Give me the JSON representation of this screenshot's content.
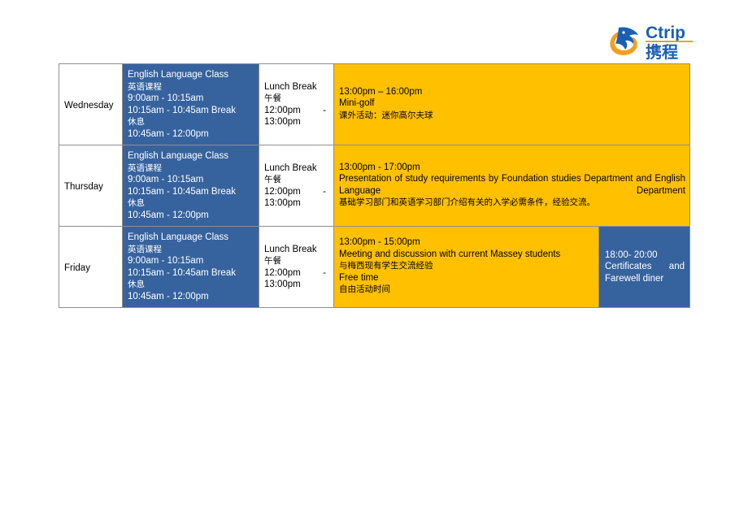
{
  "brand": {
    "name": "Ctrip",
    "name_cn": "携程",
    "logo_icon": "dolphin-icon",
    "blue": "#1a5fb4",
    "orange": "#f0a020"
  },
  "colors": {
    "class_cell_bg": "#36639e",
    "activity_cell_bg": "#ffc000",
    "evening_cell_bg": "#36639e",
    "border": "#8f8f8f"
  },
  "schedule": {
    "rows": [
      {
        "day": "Wednesday",
        "class": {
          "title_en": "English Language Class",
          "title_cn": "英语课程",
          "time1": "9:00am - 10:15am",
          "break_en": "10:15am - 10:45am Break",
          "break_cn": "休息",
          "time2": "10:45am - 12:00pm"
        },
        "lunch": {
          "title_en": "Lunch Break",
          "title_cn": "午餐",
          "start": "12:00pm",
          "dash": "-",
          "end": "13:00pm"
        },
        "activity": {
          "time": "13:00pm – 16:00pm",
          "title_en": "Mini-golf",
          "title_cn": "课外活动：迷你高尔夫球",
          "line2_en": "",
          "line2_cn": ""
        },
        "evening": null
      },
      {
        "day": "Thursday",
        "class": {
          "title_en": "English Language Class",
          "title_cn": "英语课程",
          "time1": "9:00am - 10:15am",
          "break_en": "10:15am - 10:45am Break",
          "break_cn": "休息",
          "time2": "10:45am - 12:00pm"
        },
        "lunch": {
          "title_en": "Lunch Break",
          "title_cn": "午餐",
          "start": "12:00pm",
          "dash": "-",
          "end": "13:00pm"
        },
        "activity": {
          "time": "13:00pm - 17:00pm",
          "title_en": "Presentation of study requirements by Foundation studies Department and English Language Department",
          "title_cn": "基础学习部门和英语学习部门介绍有关的入学必需条件，经验交流。",
          "line2_en": "",
          "line2_cn": ""
        },
        "evening": null
      },
      {
        "day": "Friday",
        "class": {
          "title_en": "English Language Class",
          "title_cn": "英语课程",
          "time1": "9:00am - 10:15am",
          "break_en": "10:15am - 10:45am Break",
          "break_cn": "休息",
          "time2": "10:45am - 12:00pm"
        },
        "lunch": {
          "title_en": "Lunch Break",
          "title_cn": "午餐",
          "start": "12:00pm",
          "dash": "-",
          "end": "13:00pm"
        },
        "activity": {
          "time": "13:00pm - 15:00pm",
          "title_en": "Meeting and discussion with current  Massey students",
          "title_cn": "与梅西现有学生交流经验",
          "line2_en": "Free time",
          "line2_cn": "自由活动时间"
        },
        "evening": {
          "time": "18:00- 20:00",
          "line1": "Certificates        and",
          "line2": "Farewell diner"
        }
      }
    ]
  }
}
